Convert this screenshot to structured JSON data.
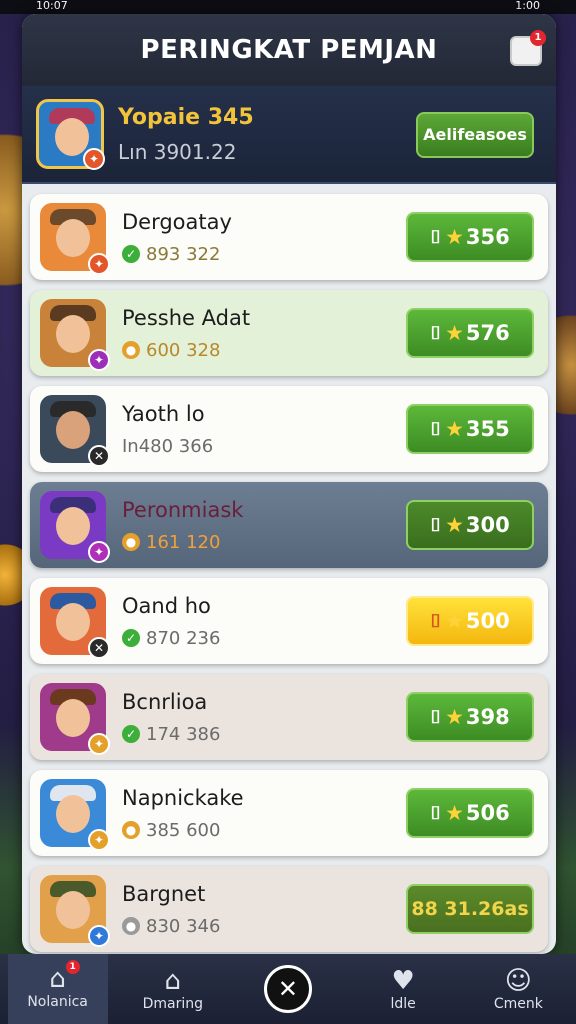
{
  "status": {
    "time": "10:07",
    "battery": "1:00"
  },
  "header": {
    "title": "PERINGKAT PEMJAN",
    "inbox_badge": "1"
  },
  "player": {
    "name": "Yopaie 345",
    "score": "Lın 3901.22",
    "button": "Aelifeasoes"
  },
  "rows": [
    {
      "name": "Dergoatay",
      "stat": "893 322",
      "score": "356",
      "stat_icon": "check-icon",
      "hat": "#6b4a2b",
      "badge": "#e3562a"
    },
    {
      "name": "Pesshe Adat",
      "stat": "600 328",
      "score": "576",
      "stat_icon": "coin-icon",
      "hat": "#5a3a20",
      "badge": "#9b2fb8"
    },
    {
      "name": "Yaoth lo",
      "stat": "In480 366",
      "score": "355",
      "stat_icon": "",
      "hat": "#2a2a2a",
      "badge": "#2a2a2a"
    },
    {
      "name": "Peronmiask",
      "stat": "161 120",
      "score": "300",
      "stat_icon": "coin-icon",
      "hat": "#3c2f7a",
      "badge": "#b02fb8"
    },
    {
      "name": "Oand ho",
      "stat": "870 236",
      "score": "500",
      "stat_icon": "check-icon",
      "hat": "#2b5aa0",
      "badge": "#2a2a2a"
    },
    {
      "name": "Bcnrlioa",
      "stat": "174 386",
      "score": "398",
      "stat_icon": "check-icon",
      "hat": "#6b3a1e",
      "badge": "#e3a02a"
    },
    {
      "name": "Napnickake",
      "stat": "385 600",
      "score": "506",
      "stat_icon": "coin-icon",
      "hat": "#dfe6ef",
      "badge": "#e3a02a"
    },
    {
      "name": "Bargnet",
      "stat": "830 346",
      "score": "88 31.26as",
      "stat_icon": "gray-coin-icon",
      "hat": "#4a5a2b",
      "badge": "#2f7ad8"
    }
  ],
  "nav": [
    {
      "label": "Nolanica",
      "icon": "home-icon"
    },
    {
      "label": "Dmaring",
      "icon": "shop-icon"
    },
    {
      "label": "",
      "icon": "battle-icon"
    },
    {
      "label": "ldle",
      "icon": "heart-icon"
    },
    {
      "label": "Cmenk",
      "icon": "profile-icon"
    }
  ],
  "nav_badge": "1",
  "colors": {
    "accent_green": "#4fa82e",
    "gold": "#f3c33b",
    "highlight_row": "#5f6f84"
  }
}
